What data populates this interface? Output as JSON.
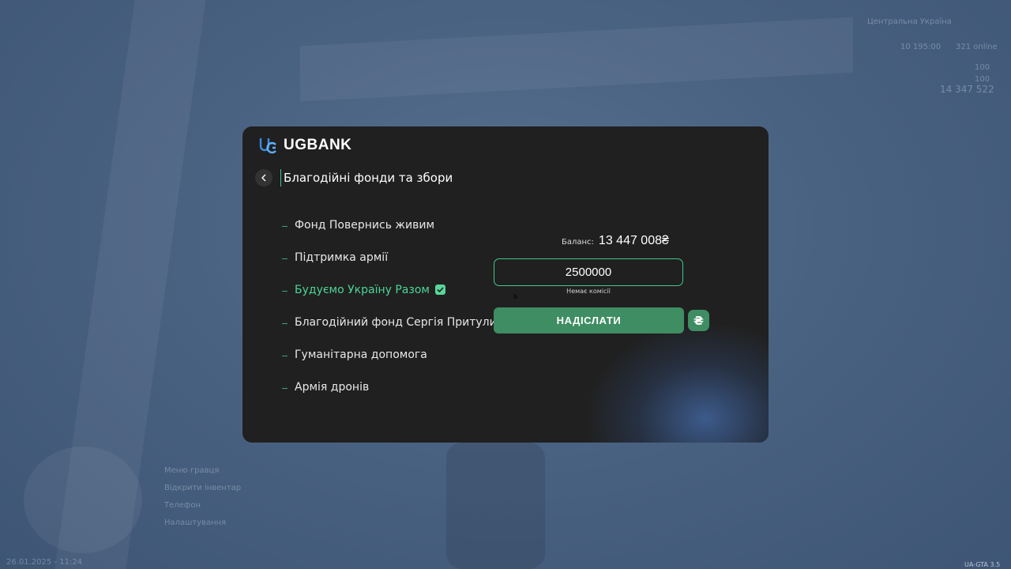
{
  "app": {
    "brand": "UGBANK",
    "page_title": "Благодійні фонди та збори"
  },
  "funds": [
    {
      "label": "Фонд Повернись живим",
      "selected": false
    },
    {
      "label": "Підтримка армії",
      "selected": false
    },
    {
      "label": "Будуємо Україну Разом",
      "selected": true
    },
    {
      "label": "Благодійний фонд Сергія Притули",
      "selected": false
    },
    {
      "label": "Гуманітарна допомога",
      "selected": false
    },
    {
      "label": "Армія дронів",
      "selected": false
    }
  ],
  "transfer": {
    "balance_label": "Баланс:",
    "balance_value": "13 447 008₴",
    "amount": "2500000",
    "fee_note": "Немає комісії",
    "send_label": "НАДІСЛАТИ",
    "currency_symbol": "₴"
  },
  "hud": {
    "location": "Центральна Україна",
    "stats_a": "10 195:00",
    "stats_b": "321 online",
    "bar_a": "100",
    "bar_b": "100",
    "money": "14 347 522",
    "date_time": "26.01.2025 - 11:24",
    "version": "UA-GTA 3.5",
    "menu_items": [
      "Меню гравця",
      "Відкрити інвентар",
      "Телефон",
      "Налаштування"
    ]
  },
  "colors": {
    "accent": "#3fc98a",
    "selected_text": "#4cd596",
    "button": "#3f8d63",
    "modal_bg": "#202020"
  }
}
